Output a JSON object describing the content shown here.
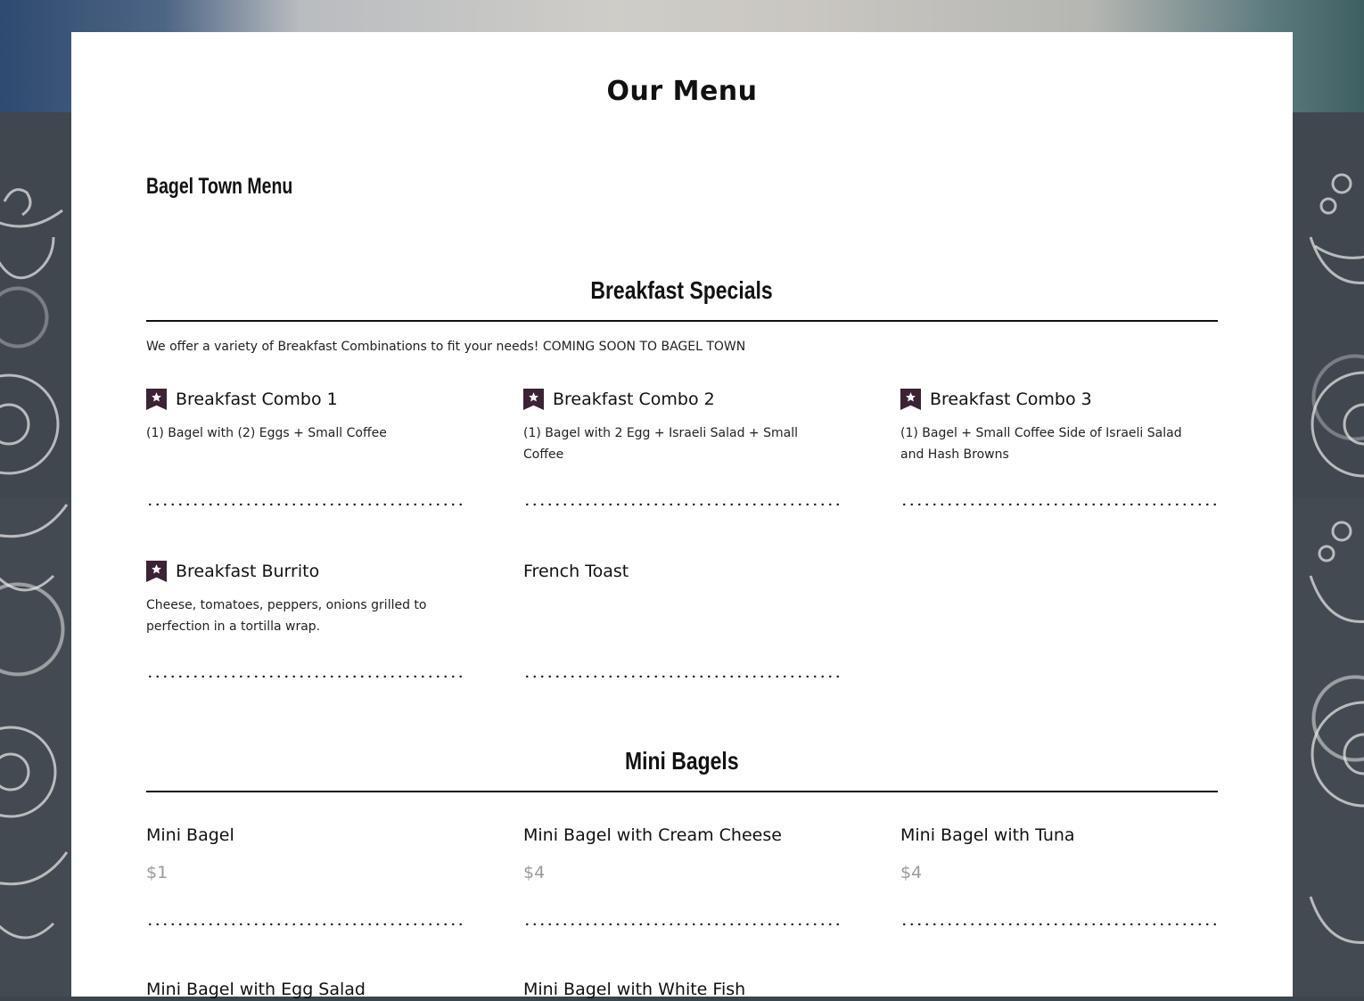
{
  "page_title": "Our Menu",
  "brand": "Bagel Town Menu",
  "sections": [
    {
      "title": "Breakfast Specials",
      "description": "We offer a variety of Breakfast Combinations to fit your needs! COMING SOON TO BAGEL TOWN",
      "items": [
        {
          "name": "Breakfast Combo 1",
          "description": "(1) Bagel with (2) Eggs + Small Coffee",
          "featured": true
        },
        {
          "name": "Breakfast Combo 2",
          "description": "(1) Bagel with 2 Egg + Israeli Salad + Small Coffee",
          "featured": true
        },
        {
          "name": "Breakfast Combo 3",
          "description": "(1) Bagel + Small Coffee Side of Israeli Salad and Hash Browns",
          "featured": true
        },
        {
          "name": "Breakfast Burrito",
          "description": "Cheese, tomatoes, peppers, onions grilled to perfection in a tortilla wrap.",
          "featured": true
        },
        {
          "name": "French Toast",
          "description": "",
          "featured": false
        }
      ]
    },
    {
      "title": "Mini Bagels",
      "items": [
        {
          "name": "Mini Bagel",
          "price": "$1"
        },
        {
          "name": "Mini Bagel with Cream Cheese",
          "price": "$4"
        },
        {
          "name": "Mini Bagel with Tuna",
          "price": "$4"
        },
        {
          "name": "Mini Bagel with Egg Salad",
          "price": ""
        },
        {
          "name": "Mini Bagel with White Fish",
          "price": ""
        }
      ]
    }
  ],
  "colors": {
    "badge": "#3b2235",
    "price": "#9a9a9a",
    "card": "#ffffff",
    "text": "#111111"
  },
  "icons": {
    "featured": "star-bookmark-icon"
  }
}
